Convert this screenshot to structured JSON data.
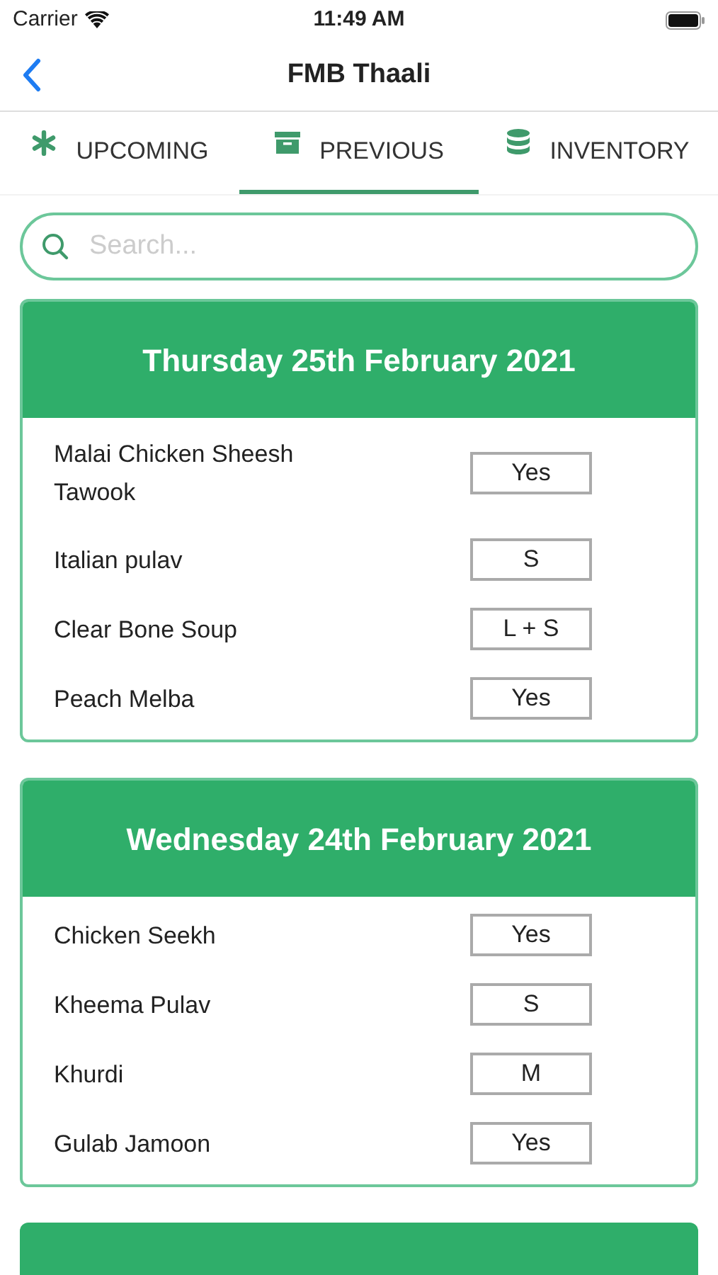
{
  "status_bar": {
    "carrier": "Carrier",
    "time": "11:49 AM"
  },
  "nav": {
    "title": "FMB Thaali"
  },
  "tabs": [
    {
      "label": "UPCOMING",
      "kind": "asterisk",
      "selected": false
    },
    {
      "label": "PREVIOUS",
      "kind": "archive",
      "selected": true
    },
    {
      "label": "INVENTORY",
      "kind": "database",
      "selected": false
    }
  ],
  "search": {
    "placeholder": "Search..."
  },
  "days": [
    {
      "date": "Thursday 25th February 2021",
      "items": [
        {
          "name": "Malai Chicken Sheesh Tawook",
          "value": "Yes"
        },
        {
          "name": "Italian pulav",
          "value": "S"
        },
        {
          "name": "Clear Bone Soup",
          "value": "L + S"
        },
        {
          "name": "Peach Melba",
          "value": "Yes"
        }
      ]
    },
    {
      "date": "Wednesday 24th February 2021",
      "items": [
        {
          "name": "Chicken Seekh",
          "value": "Yes"
        },
        {
          "name": "Kheema Pulav",
          "value": "S"
        },
        {
          "name": "Khurdi",
          "value": "M"
        },
        {
          "name": "Gulab Jamoon",
          "value": "Yes"
        }
      ]
    }
  ]
}
